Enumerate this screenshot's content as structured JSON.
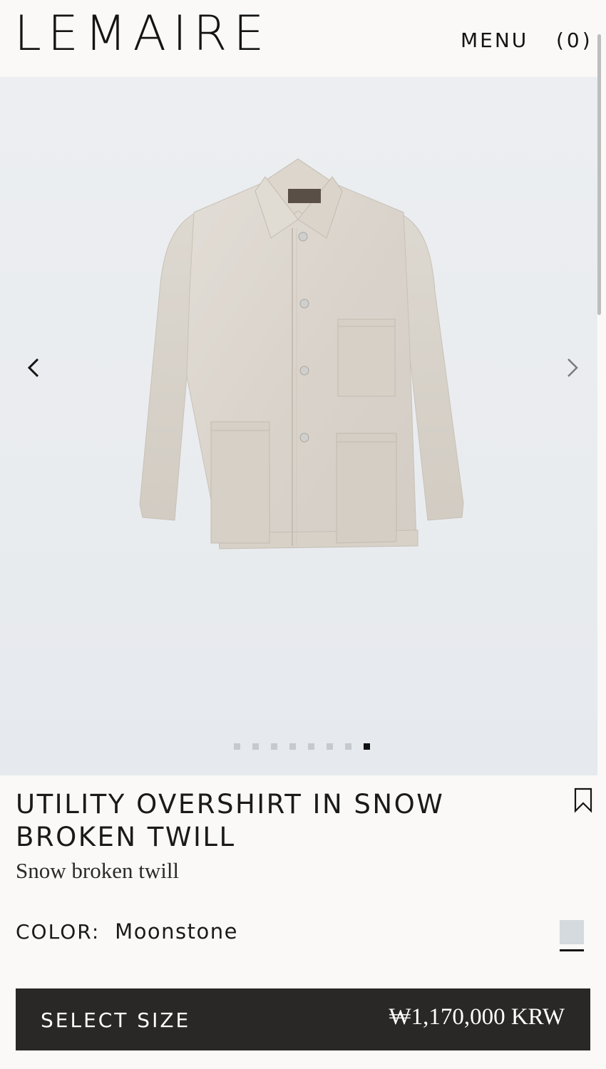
{
  "header": {
    "logo": "LEMAIRE",
    "menu_label": "MENU",
    "cart_label": "(0)"
  },
  "gallery": {
    "image_icon": "utility-overshirt-product-photo",
    "prev_icon": "chevron-left-icon",
    "next_icon": "chevron-right-icon",
    "slide_count": 8,
    "active_slide": 8
  },
  "product": {
    "title": "UTILITY OVERSHIRT IN SNOW BROKEN TWILL",
    "subtitle": "Snow broken twill",
    "bookmark_icon": "bookmark-icon",
    "color_label": "COLOR:",
    "color_value": "Moonstone",
    "swatch_color": "#d4dadd"
  },
  "cta": {
    "label": "SELECT SIZE",
    "price": "₩1,170,000 KRW"
  },
  "colors": {
    "background": "#faf9f7",
    "cta_background": "#2a2826",
    "text": "#1b1a19"
  }
}
